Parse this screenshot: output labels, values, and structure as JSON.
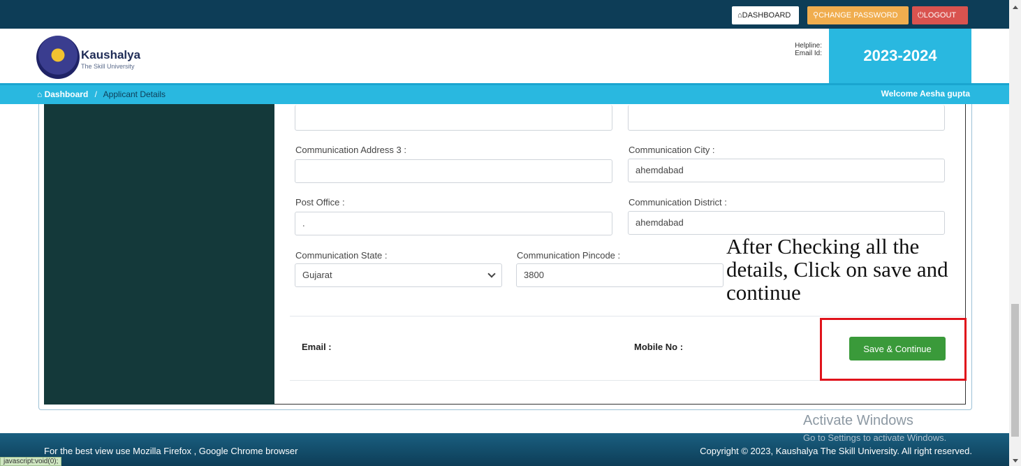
{
  "topbar": {
    "dashboard_label": "DASHBOARD",
    "change_password_label": "CHANGE PASSWORD",
    "logout_label": "LOGOUT",
    "dashboard_icon": "home-icon",
    "change_password_icon": "key-icon",
    "logout_icon": "power-icon"
  },
  "header": {
    "logo_name": "Kaushalya",
    "logo_sub": "The Skill University",
    "helpline_label": "Helpline:",
    "email_label": "Email Id:",
    "year": "2023-2024"
  },
  "breadcrumb": {
    "home": "Dashboard",
    "separator": "/",
    "current": "Applicant Details",
    "welcome": "Welcome Aesha gupta"
  },
  "form": {
    "addr3_label": "Communication Address 3 :",
    "addr3_value": "",
    "city_label": "Communication City :",
    "city_value": "ahemdabad",
    "post_office_label": "Post Office :",
    "post_office_value": ".",
    "district_label": "Communication District :",
    "district_value": "ahemdabad",
    "state_label": "Communication State :",
    "state_value": "Gujarat",
    "pincode_label": "Communication Pincode :",
    "pincode_value": "3800",
    "email_label": "Email :",
    "mobile_label": "Mobile No :",
    "save_label": "Save & Continue"
  },
  "annotation": "After Checking all the details, Click on save and continue",
  "watermark": {
    "title": "Activate Windows",
    "subtitle": "Go to Settings to activate Windows."
  },
  "footer": {
    "left": "For the best view use Mozilla Firefox , Google Chrome browser",
    "right": "Copyright © 2023, Kaushalya The Skill University. All right reserved.",
    "status": "javascript:void(0);"
  },
  "colors": {
    "navy": "#0d3d57",
    "accent": "#29b8e0",
    "save": "#3a9a3a",
    "highlight": "#e0131b"
  }
}
